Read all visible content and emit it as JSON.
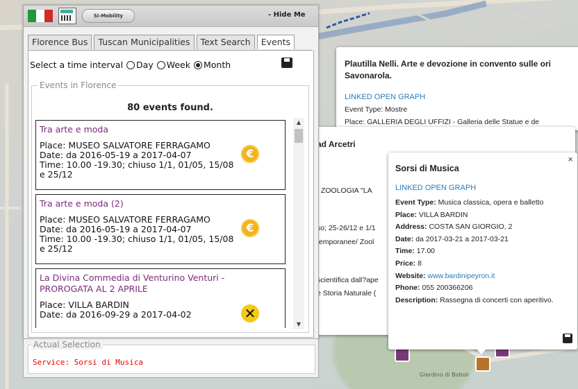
{
  "topbar": {
    "hide_label": "- Hide Me",
    "logo_text": "Si-Mobility"
  },
  "flag": {
    "green": "#1f9a3a",
    "white": "#ffffff",
    "red": "#d22a2a"
  },
  "tabs": [
    {
      "label": "Florence Bus",
      "active": false
    },
    {
      "label": "Tuscan Municipalities",
      "active": false
    },
    {
      "label": "Text Search",
      "active": false
    },
    {
      "label": "Events",
      "active": true
    }
  ],
  "interval": {
    "label": "Select a time interval",
    "options": [
      "Day",
      "Week",
      "Month"
    ],
    "selected": "Month"
  },
  "events_panel": {
    "legend": "Events in Florence",
    "count_text": "80 events found."
  },
  "events": [
    {
      "title": "Tra arte e moda",
      "place": "Place: MUSEO SALVATORE FERRAGAMO",
      "date": "Date: da 2016-05-19 a 2017-04-07",
      "time": "Time: 10.00 -19.30; chiuso 1/1, 01/05, 15/08 e 25/12",
      "price_icon": "euro-coin-icon"
    },
    {
      "title": "Tra arte e moda (2)",
      "place": "Place: MUSEO SALVATORE FERRAGAMO",
      "date": "Date: da 2016-05-19 a 2017-04-07",
      "time": "Time: 10.00 -19.30; chiuso 1/1, 01/05, 15/08 e 25/12",
      "price_icon": "euro-coin-icon"
    },
    {
      "title": "La Divina Commedia di Venturino Venturi - PROROGATA AL 2 APRILE",
      "place": "Place: VILLA BARDIN",
      "date": "Date: da 2016-09-29 a 2017-04-02",
      "time": "",
      "price_icon": "free-icon"
    }
  ],
  "actual_selection": {
    "legend": "Actual Selection",
    "service": "Service: Sorsi di Musica"
  },
  "popup_back": {
    "title": "Plautilla Nelli. Arte e devozione in convento sulle ori Savonarola.",
    "link": "LINKED OPEN GRAPH",
    "event_type": "Event Type: Mostre",
    "place": "Place: GALLERIA DEGLI UFFIZI - Galleria delle Statue e de"
  },
  "popup_mid": {
    "title": "ad Arcetri",
    "lines": [
      "I ZOOLOGIA \"LA",
      "so; 25-26/12 e 1/1",
      "temporanee/ Zool",
      "scientifica dall?ape",
      "e Storia Naturale ("
    ]
  },
  "popup_front": {
    "title": "Sorsi di Musica",
    "link": "LINKED OPEN GRAPH",
    "event_type_label": "Event Type:",
    "event_type": "Musica classica, opera e balletto",
    "place_label": "Place:",
    "place": "VILLA BARDIN",
    "address_label": "Address:",
    "address": "COSTA SAN GIORGIO, 2",
    "date_label": "Date:",
    "date": "da 2017-03-21 a 2017-03-21",
    "time_label": "Time:",
    "time": "17.00",
    "price_label": "Price:",
    "price": "8",
    "website_label": "Website:",
    "website": "www.bardinipeyron.it",
    "phone_label": "Phone:",
    "phone": "055 200366206",
    "description_label": "Description:",
    "description": "Rassegna di concerti con aperitivo.",
    "close": "×"
  },
  "map_labels": {
    "garden": "Giardino di Boboli"
  }
}
